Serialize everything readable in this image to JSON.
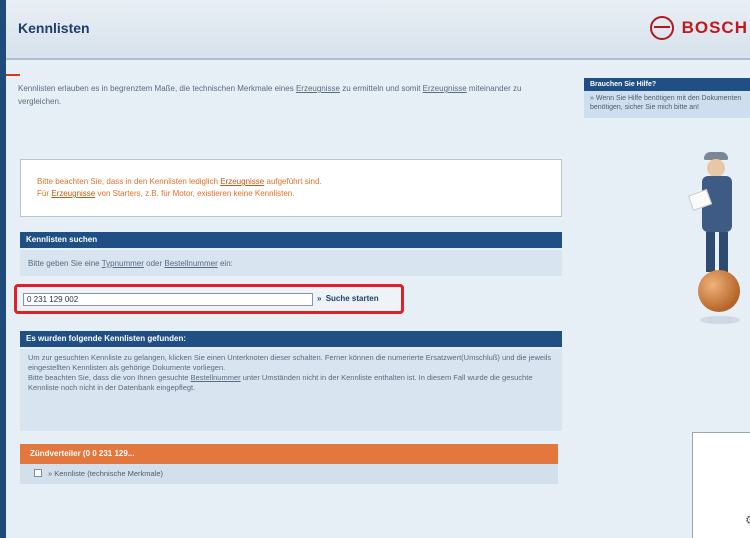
{
  "header": {
    "title": "Kennlisten",
    "brand": "BOSCH"
  },
  "intro": {
    "part1": "Kennlisten erlauben es in begrenztem Maße, die technischen Merkmale eines ",
    "link1": "Erzeugnisse",
    "part2": " zu ermitteln und somit ",
    "link2": "Erzeugnisse",
    "part3": " miteinander zu vergleichen."
  },
  "side_panel": {
    "title": "Brauchen Sie Hilfe?",
    "text": "» Wenn Sie Hilfe benötigen mit den Dokumenten benötigen, sicher Sie mich bitte an!"
  },
  "notice": {
    "line1_a": "Bitte beachten Sie, dass in den Kennlisten lediglich ",
    "line1_link": "Erzeugnisse",
    "line1_b": " aufgeführt sind.",
    "line2_a": "Für ",
    "line2_link": "Erzeugnisse",
    "line2_b": " von Starters, z.B. für Motor, existieren keine Kennlisten."
  },
  "search": {
    "section_title": "Kennlisten suchen",
    "hint_a": "Bitte geben Sie eine ",
    "hint_link1": "Typnummer",
    "hint_mid": " oder ",
    "hint_link2": "Bestellnummer",
    "hint_b": " ein:",
    "input_value": "0 231 129 002",
    "button_label": "Suche starten",
    "button_arrow": "»"
  },
  "results": {
    "section_title": "Es wurden folgende Kennlisten gefunden:",
    "info1": "Um zur gesuchten Kennliste zu gelangen, klicken Sie einen Unterknoten dieser schalten. Ferner können die numerierte Ersatzwert(Umschluß) und die jeweils eingestellten Kennlisten als gehörige Dokumente vorliegen.",
    "info2_a": "Bitte beachten Sie, dass die von Ihnen gesuchte ",
    "info2_link": "Bestellnummer",
    "info2_b": " unter Umständen nicht in der Kennliste enthalten ist. In diesem Fall wurde die gesuchte Kennliste noch nicht in der Datenbank eingepflegt.",
    "group_label": "Zündverteiler (0 0 231 129...",
    "item_label": "» Kennliste (technische Merkmale)"
  }
}
